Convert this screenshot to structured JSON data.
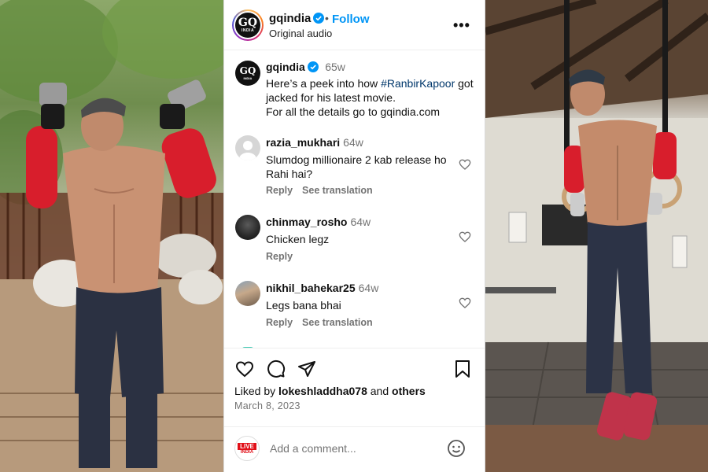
{
  "header": {
    "username": "gqindia",
    "follow_label": "Follow",
    "dot": "•",
    "audio_label": "Original audio",
    "more_label": "•••",
    "avatar_logo": "GQ",
    "avatar_logo_sub": "INDIA"
  },
  "caption": {
    "username": "gqindia",
    "time": "65w",
    "text_before": "Here’s a peek into how ",
    "hashtag": "#RanbirKapoor",
    "text_after": " got jacked for his latest movie.",
    "text_line2": "For all the details go to gqindia.com"
  },
  "comments": [
    {
      "username": "razia_mukhari",
      "time": "64w",
      "text": "Slumdog millionaire 2 kab release ho Rahi hai?",
      "reply_label": "Reply",
      "translate_label": "See translation"
    },
    {
      "username": "chinmay_rosho",
      "time": "64w",
      "text": "Chicken legz",
      "reply_label": "Reply"
    },
    {
      "username": "nikhil_bahekar25",
      "time": "64w",
      "text": "Legs bana bhai",
      "reply_label": "Reply",
      "translate_label": "See translation"
    }
  ],
  "actions": {
    "icons": [
      "heart-icon",
      "comment-icon",
      "share-icon",
      "bookmark-icon"
    ]
  },
  "likes": {
    "prefix": "Liked by ",
    "user": "lokeshladdha078",
    "middle": " and ",
    "others": "others"
  },
  "date": "March 8, 2023",
  "add_comment": {
    "placeholder": "Add a comment...",
    "commenter_logo_line1": "LIVE",
    "commenter_logo_line2": "INDIA"
  },
  "colors": {
    "link_blue": "#0095f6",
    "hashtag": "#00376b",
    "muted": "#737373",
    "verified": "#0095f6",
    "live_red": "#e10f18"
  }
}
